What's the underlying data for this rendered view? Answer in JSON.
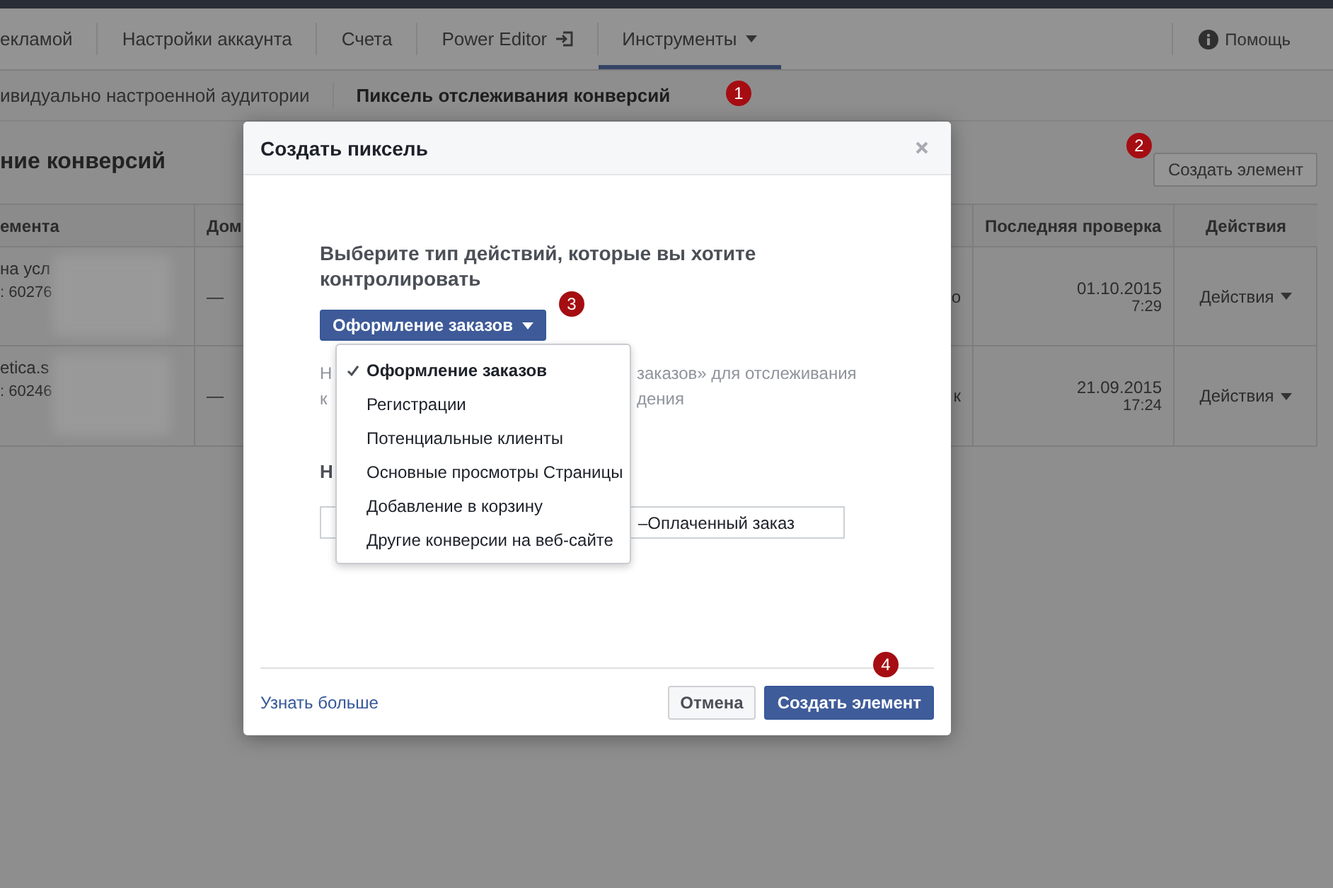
{
  "top_nav": {
    "tabs": [
      {
        "label": "екламой",
        "kind": "plain",
        "selected": false
      },
      {
        "label": "Настройки аккаунта",
        "kind": "plain",
        "selected": false
      },
      {
        "label": "Счета",
        "kind": "plain",
        "selected": false
      },
      {
        "label": "Power Editor",
        "kind": "external",
        "selected": false
      },
      {
        "label": "Инструменты",
        "kind": "menu",
        "selected": true
      }
    ],
    "help": "Помощь"
  },
  "sub_tabs": [
    {
      "label": "ивидуально настроенной аудитории",
      "selected": false
    },
    {
      "label": "Пиксель отслеживания конверсий",
      "selected": true
    }
  ],
  "page": {
    "heading": "ние конверсий",
    "create_button": "Создать элемент"
  },
  "table": {
    "columns": [
      "емента",
      "Дом",
      "Последняя проверка",
      "Действия"
    ],
    "rows": [
      {
        "name": "на усл",
        "id": ": 60276",
        "domain": "—",
        "column_3": "о",
        "date": "01.10.2015",
        "time": "7:29",
        "actions": "Действия"
      },
      {
        "name": "etica.s",
        "id": ": 60246",
        "domain": "—",
        "column_3": "к",
        "date": "21.09.2015",
        "time": "17:24",
        "actions": "Действия"
      }
    ]
  },
  "dialog": {
    "title": "Создать пиксель",
    "question": "Выберите тип действий, которые вы хотите контролировать",
    "type_button": "Оформление заказов",
    "description": [
      [
        "Н",
        "заказов» для отслеживания"
      ],
      [
        "к",
        "дения"
      ]
    ],
    "menu": [
      {
        "label": "Оформление заказов",
        "selected": true
      },
      {
        "label": "Регистрации",
        "selected": false
      },
      {
        "label": "Потенциальные клиенты",
        "selected": false
      },
      {
        "label": "Основные просмотры Страницы",
        "selected": false
      },
      {
        "label": "Добавление в корзину",
        "selected": false
      },
      {
        "label": "Другие конверсии на веб-сайте",
        "selected": false
      }
    ],
    "name_label": "Н",
    "name_value": "–Оплаченный заказ",
    "learn_more": "Узнать больше",
    "cancel": "Отмена",
    "submit": "Создать элемент"
  },
  "markers": [
    "1",
    "2",
    "3",
    "4"
  ]
}
